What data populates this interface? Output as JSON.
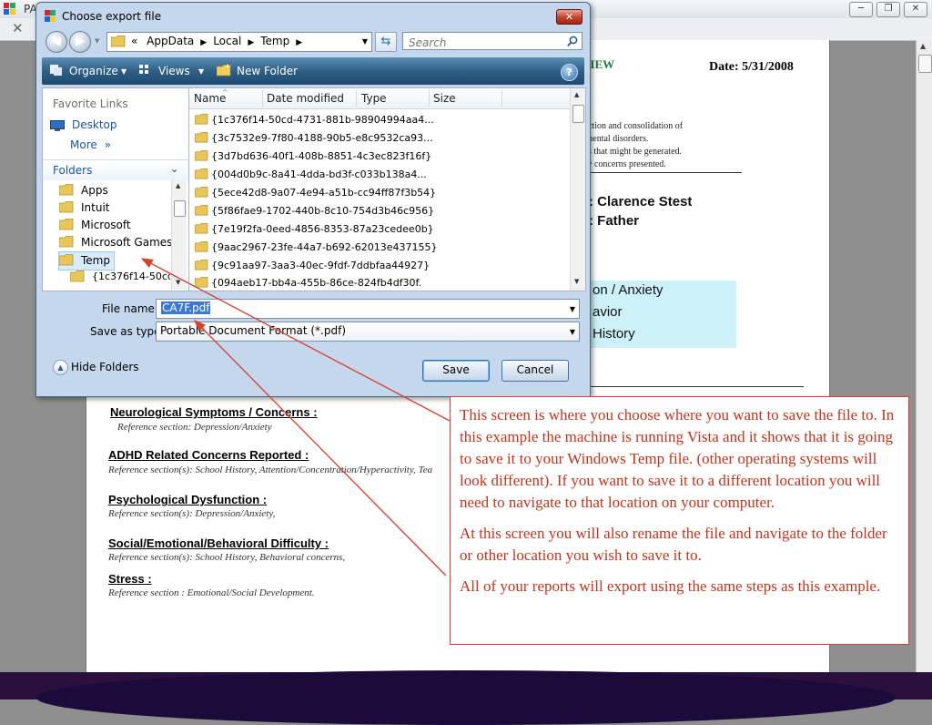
{
  "app": {
    "title": "PA",
    "window_controls": [
      "─",
      "❐",
      "✕"
    ],
    "toolbar_close": "✕"
  },
  "document": {
    "header_partial": "VIEW",
    "date": "Date: 5/31/2008",
    "intro_lines": [
      "llection and consolidation of",
      "y mental disorders.",
      "ons that might be generated.",
      "any concerns presented."
    ],
    "patient_line": ": Clarence Stest",
    "relation_line": ": Father",
    "cyan_lines": [
      "on / Anxiety",
      "avior",
      "History"
    ],
    "sections": [
      {
        "title": "Neurological Symptoms / Concerns :",
        "ref": "Reference section: Depression/Anxiety"
      },
      {
        "title": "ADHD Related Concerns Reported :",
        "ref": "Reference section(s): School History, Attention/Concentration/Hyperactivity, Tea"
      },
      {
        "title": "Psychological Dysfunction :",
        "ref": "Reference section(s): Depression/Anxiety,"
      },
      {
        "title": "Social/Emotional/Behavioral Difficulty :",
        "ref": "Reference section(s): School History, Behavioral concerns,"
      },
      {
        "title": "Stress :",
        "ref": "Reference section : Emotional/Social Development."
      }
    ]
  },
  "dialog": {
    "title": "Choose export file",
    "close_glyph": "✕",
    "nav_back": "◀",
    "nav_forward": "▶",
    "breadcrumb_prefix": "«",
    "breadcrumb": [
      "AppData",
      "Local",
      "Temp"
    ],
    "search_placeholder": "Search",
    "toolbar": {
      "organize": "Organize",
      "views": "Views",
      "new_folder": "New Folder",
      "help": "?"
    },
    "nav_pane": {
      "favorite_links_label": "Favorite Links",
      "desktop": "Desktop",
      "more": "More",
      "more_glyph": "»",
      "folders_label": "Folders",
      "tree": [
        "Apps",
        "Intuit",
        "Microsoft",
        "Microsoft Games",
        "Temp",
        "{1c376f14-50cd-4"
      ],
      "selected": "Temp"
    },
    "columns": [
      "Name",
      "Date modified",
      "Type",
      "Size"
    ],
    "files": [
      "{1c376f14-50cd-4731-881b-98904994aa4...",
      "{3c7532e9-7f80-4188-90b5-e8c9532ca93...",
      "{3d7bd636-40f1-408b-8851-4c3ec823f16f}",
      "{004d0b9c-8a41-4dda-bd3f-c033b138a4...",
      "{5ece42d8-9a07-4e94-a51b-cc94ff87f3b54}",
      "{5f86fae9-1702-440b-8c10-754d3b46c956}",
      "{7e19f2fa-0eed-4856-8353-87a23cedee0b}",
      "{9aac2967-23fe-44a7-b692-62013e437155}",
      "{9c91aa97-3aa3-40ec-9fdf-7ddbfaa44927}",
      "{094aeb17-bb4a-455b-86ce-824fb4df30f..."
    ],
    "file_name_label": "File name:",
    "file_name_value": "CA7F.pdf",
    "save_type_label": "Save as type:",
    "save_type_value": "Portable Document Format (*.pdf)",
    "hide_folders": "Hide Folders",
    "save_button": "Save",
    "cancel_button": "Cancel"
  },
  "annotation": {
    "paragraphs": [
      "This screen is where you choose where you want to save the file to. In this example the machine is running Vista and it shows that it is going to save it to your Windows Temp file. (other operating systems will look different).  If you want to save it to a different location you will need to navigate to that location on your computer.",
      "At this screen you will also rename the file and navigate to the folder or other location you wish to save it to.",
      "All of your reports will export using the same steps as this example."
    ],
    "color": "#c8321b"
  }
}
